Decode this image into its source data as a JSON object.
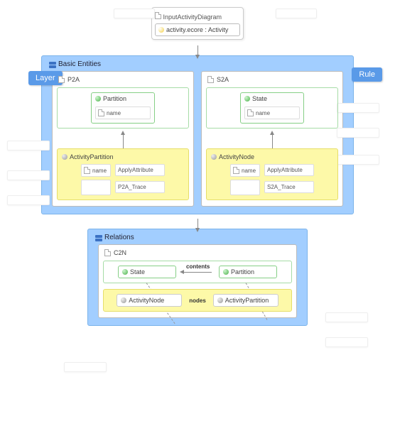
{
  "header": {
    "title": "InputActivityDiagram",
    "content": "activity.ecore : Activity"
  },
  "tags": {
    "layer": "Layer",
    "rule": "Rule"
  },
  "basicEntities": {
    "title": "Basic Entities",
    "p2a": {
      "title": "P2A",
      "top_entity": "Partition",
      "top_attr": "name",
      "bottom_title": "ActivityPartition",
      "bottom_left_attr": "name",
      "bottom_right_title": "ApplyAttribute",
      "bottom_right_attr": "P2A_Trace"
    },
    "s2a": {
      "title": "S2A",
      "top_entity": "State",
      "top_attr": "name",
      "bottom_title": "ActivityNode",
      "bottom_left_attr": "name",
      "bottom_right_title": "ApplyAttribute",
      "bottom_right_attr": "S2A_Trace"
    }
  },
  "relations": {
    "title": "Relations",
    "c2n": {
      "title": "C2N",
      "state": "State",
      "partition": "Partition",
      "edge1": "contents",
      "node": "ActivityNode",
      "actpart": "ActivityPartition",
      "edge2": "nodes"
    }
  }
}
